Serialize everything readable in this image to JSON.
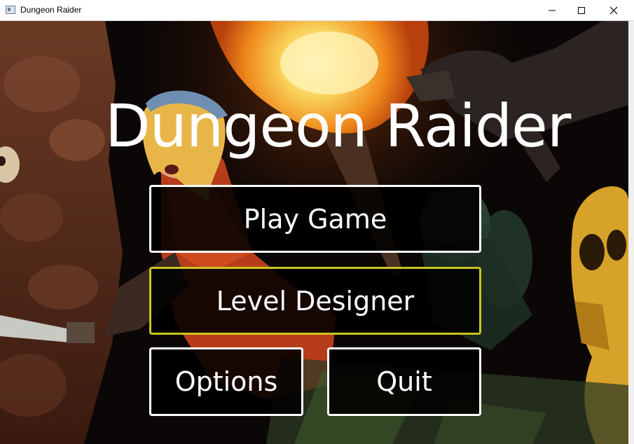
{
  "window": {
    "title": "Dungeon Raider",
    "icons": [
      "app-icon",
      "minimize-icon",
      "maximize-icon",
      "close-icon"
    ]
  },
  "game": {
    "title": "Dungeon Raider"
  },
  "menu": {
    "play_label": "Play Game",
    "level_designer_label": "Level Designer",
    "options_label": "Options",
    "quit_label": "Quit",
    "selected": "Level Designer"
  },
  "colors": {
    "button_border": "#ffffff",
    "selected_border": "#c9c51f",
    "button_fill": "#000000",
    "text": "#ffffff"
  }
}
